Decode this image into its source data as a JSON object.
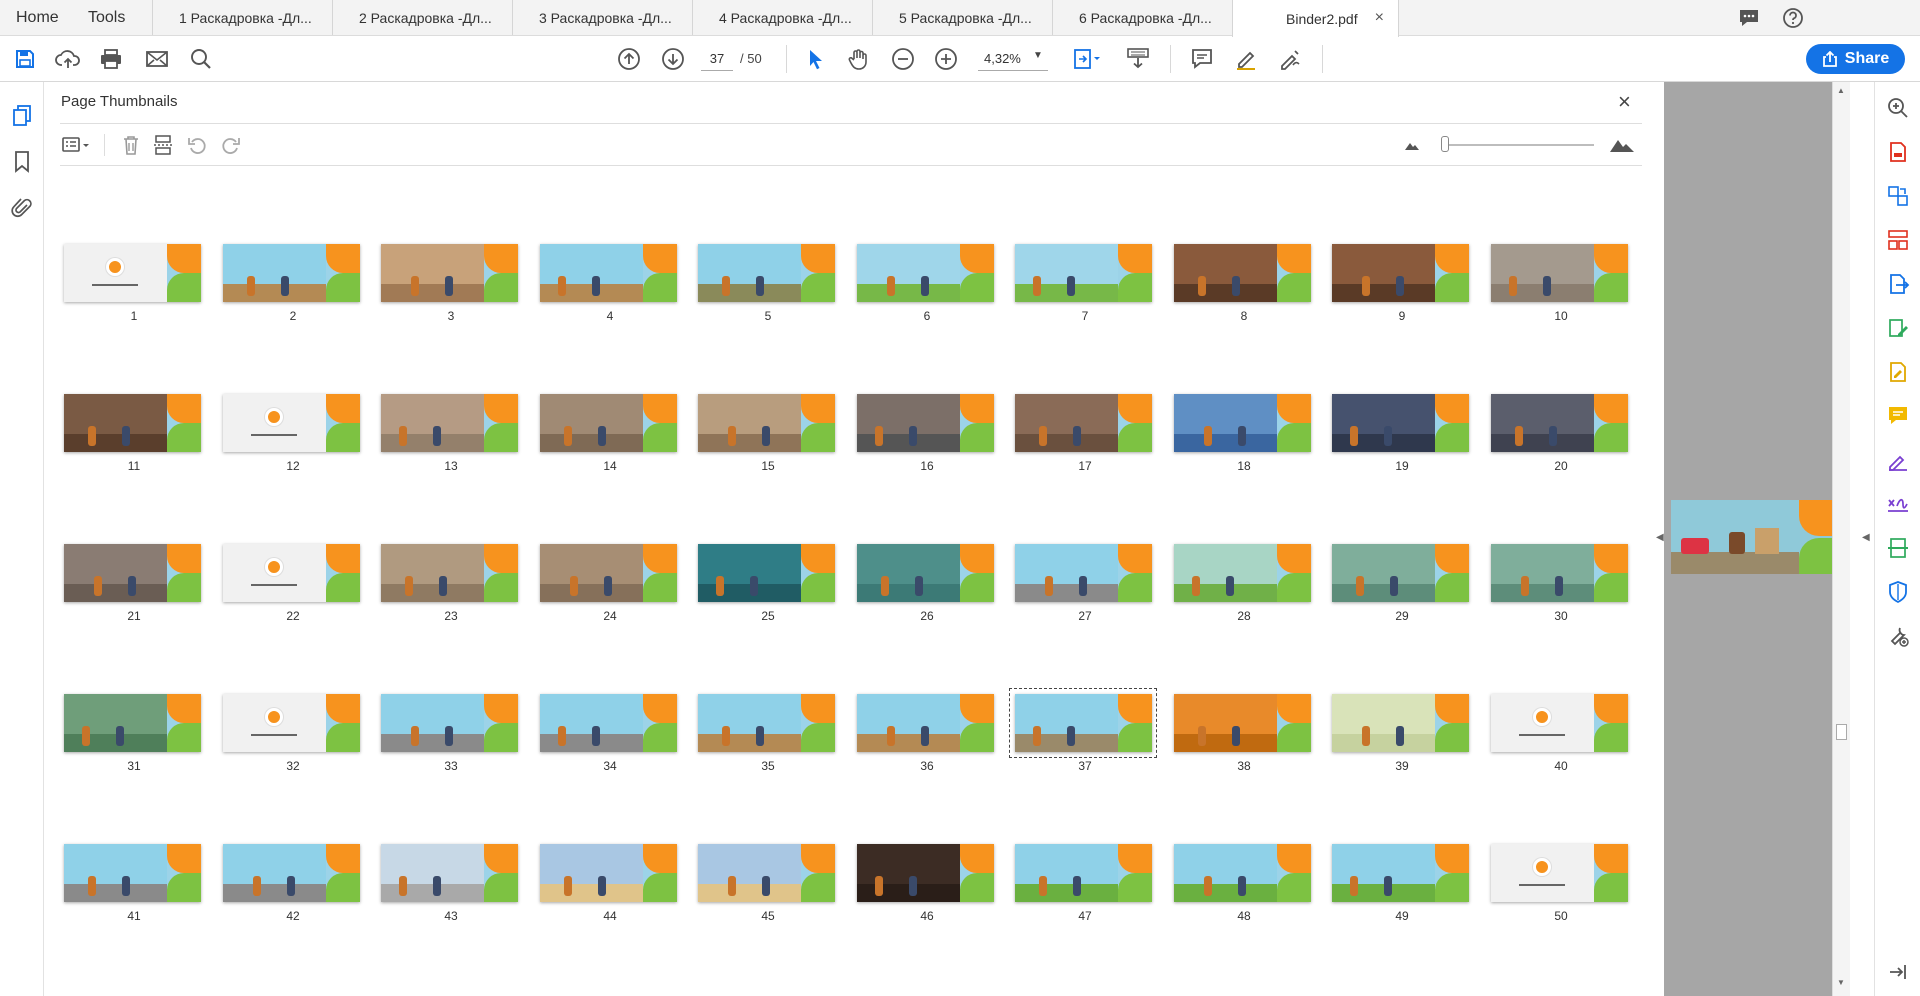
{
  "tabs": {
    "home": "Home",
    "tools": "Tools",
    "docs": [
      "1 Раскадровка -Дл...",
      "2 Раскадровка -Дл...",
      "3 Раскадровка -Дл...",
      "4 Раскадровка -Дл...",
      "5 Раскадровка -Дл...",
      "6 Раскадровка -Дл..."
    ],
    "active": "Binder2.pdf",
    "close": "×"
  },
  "toolbar": {
    "page_current": "37",
    "page_total": "/ 50",
    "zoom": "4,32%",
    "share": "Share"
  },
  "panel": {
    "title": "Page Thumbnails",
    "close": "×"
  },
  "thumbnails": {
    "selected": 37,
    "labels": [
      "1",
      "2",
      "3",
      "4",
      "5",
      "6",
      "7",
      "8",
      "9",
      "10",
      "11",
      "12",
      "13",
      "14",
      "15",
      "16",
      "17",
      "18",
      "19",
      "20",
      "21",
      "22",
      "23",
      "24",
      "25",
      "26",
      "27",
      "28",
      "29",
      "30",
      "31",
      "32",
      "33",
      "34",
      "35",
      "36",
      "37",
      "38",
      "39",
      "40",
      "41",
      "42",
      "43",
      "44",
      "45",
      "46",
      "47",
      "48",
      "49",
      "50"
    ],
    "scene_colors": [
      "#f1f1f1",
      "#8fd1e8",
      "#c8a27a",
      "#8fd1e8",
      "#8fd1e8",
      "#9fd6ea",
      "#9fd6ea",
      "#8a5a3c",
      "#8a5a3c",
      "#a49a8e",
      "#7a5a44",
      "#f1f1f1",
      "#b59b84",
      "#a08a74",
      "#b89d7e",
      "#7c6f68",
      "#8a6b57",
      "#5f8fc4",
      "#46526e",
      "#5b5e6c",
      "#8a7c73",
      "#f1f1f1",
      "#b09a80",
      "#a78e74",
      "#2f7d86",
      "#4e8f8a",
      "#8fd1e8",
      "#a8d5c5",
      "#7fae9b",
      "#7fae9b",
      "#6f9e7a",
      "#f1f1f1",
      "#8fd1e8",
      "#8fd1e8",
      "#8fd1e8",
      "#8fd1e8",
      "#8fd1e8",
      "#e88a2a",
      "#d9e3b9",
      "#f1f1f1",
      "#8fd1e8",
      "#8fd1e8",
      "#c7d8e6",
      "#a9c7e3",
      "#a9c7e3",
      "#3c2c24",
      "#8fd1e8",
      "#8fd1e8",
      "#8fd1e8",
      "#f1f1f1"
    ],
    "ground_colors": [
      "#f1f1f1",
      "#b48a54",
      "#a17a55",
      "#b48a54",
      "#8a8a5a",
      "#77b848",
      "#77b848",
      "#5a3a26",
      "#5a3a26",
      "#8b7e70",
      "#5a3e2c",
      "#f1f1f1",
      "#94806b",
      "#7f6a55",
      "#8f7458",
      "#555",
      "#6a503e",
      "#3a66a0",
      "#2f384d",
      "#3f4250",
      "#6a5d54",
      "#f1f1f1",
      "#8f7a62",
      "#86705a",
      "#205c64",
      "#3c7a76",
      "#8a8a8a",
      "#70b048",
      "#5d8d7a",
      "#5d8d7a",
      "#4f7f5a",
      "#f1f1f1",
      "#8a8a8a",
      "#8a8a8a",
      "#b48a54",
      "#b48a54",
      "#9a8a6a",
      "#c06a10",
      "#c6d29f",
      "#f1f1f1",
      "#8a8a8a",
      "#8a8a8a",
      "#a9a9a9",
      "#e0c48a",
      "#e0c48a",
      "#2a1e18",
      "#6ab040",
      "#6ab040",
      "#6ab040",
      "#f1f1f1"
    ]
  },
  "colors": {
    "accent": "#1473e6",
    "orange": "#f7931e",
    "green": "#7dc242"
  }
}
